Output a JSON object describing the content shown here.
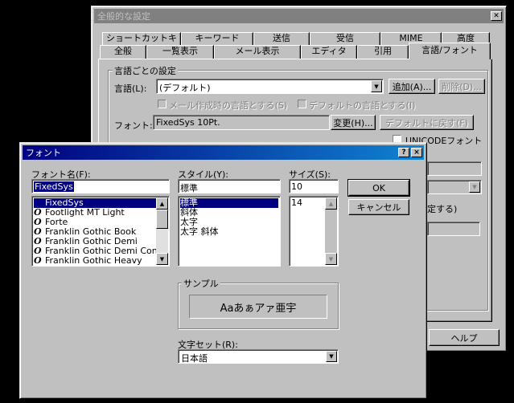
{
  "settings": {
    "title": "全般的な設定",
    "tabs_row1": [
      "ショートカットキー",
      "キーワード",
      "送信",
      "受信",
      "MIME",
      "高度"
    ],
    "tabs_row2": [
      "全般",
      "一覧表示",
      "メール表示",
      "エディタ",
      "引用",
      "言語/フォント"
    ],
    "group_label": "言語ごとの設定",
    "lang_label": "言語(L):",
    "lang_value": "(デフォルト)",
    "add_button": "追加(A)...",
    "delete_button": "削除(D)...",
    "check1": "メール作成時の言語とする(S)",
    "check2": "デフォルトの言語とする(I)",
    "font_label": "フォント:",
    "font_value": "FixedSys 10Pt.",
    "change_button": "変更(H)...",
    "default_button": "デフォルトに戻す(F)",
    "unicode_label": "UNICODEフォント",
    "partial_text": "定する)",
    "help_button": "ヘルプ"
  },
  "font": {
    "title": "フォント",
    "help_btn": "?",
    "close_btn": "×",
    "name_label": "フォント名(F):",
    "name_value": "FixedSys",
    "font_list": [
      "FixedSys",
      "Footlight MT Light",
      "Forte",
      "Franklin Gothic Book",
      "Franklin Gothic Demi",
      "Franklin Gothic Demi Con",
      "Franklin Gothic Heavy"
    ],
    "style_label": "スタイル(Y):",
    "style_value": "標準",
    "style_list": [
      "標準",
      "斜体",
      "太字",
      "太字 斜体"
    ],
    "size_label": "サイズ(S):",
    "size_value": "10",
    "size_list": [
      "14"
    ],
    "ok_button": "OK",
    "cancel_button": "キャンセル",
    "sample_label": "サンプル",
    "sample_text": "Aaあぁアァ亜宇",
    "charset_label": "文字セット(R):",
    "charset_value": "日本語"
  }
}
